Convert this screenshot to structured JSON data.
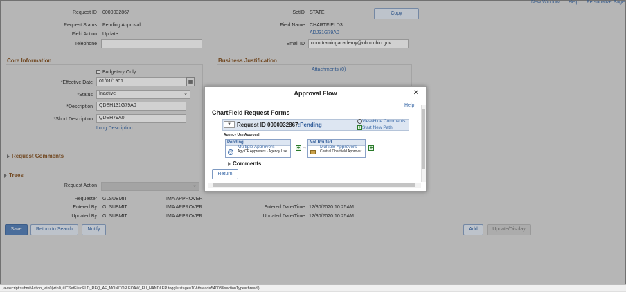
{
  "topnav": {
    "new_window": "New Window",
    "help": "Help",
    "personalize": "Personalize Page"
  },
  "header": {
    "request_id_label": "Request ID",
    "request_id": "0000032867",
    "request_status_label": "Request Status",
    "request_status": "Pending Approval",
    "field_action_label": "Field Action",
    "field_action": "Update",
    "telephone_label": "Telephone",
    "telephone": "",
    "setid_label": "SetID",
    "setid": "STATE",
    "copy_label": "Copy",
    "field_name_label": "Field Name",
    "field_name": "CHARTFIELD3",
    "field_value": "ADJ31G79A0",
    "email_label": "Email ID",
    "email": "obm.trainingacademy@obm.ohio.gov"
  },
  "core": {
    "title": "Core Information",
    "budgetary_only": "Budgetary Only",
    "eff_date_label": "*Effective Date",
    "eff_date": "01/01/1901",
    "status_label": "*Status",
    "status": "Inactive",
    "description_label": "*Description",
    "description": "QDEH131G79A0",
    "short_desc_label": "*Short Description",
    "short_desc": "QDEH79A0",
    "long_desc_link": "Long Description"
  },
  "business": {
    "title": "Business Justification",
    "attachments": "Attachments (0)"
  },
  "sections": {
    "request_comments": "Request Comments",
    "trees": "Trees"
  },
  "bottom": {
    "request_action_label": "Request Action",
    "request_action": "",
    "requester_label": "Requester",
    "requester_id": "GLSUBMIT",
    "requester_name": "IMA APPROVER",
    "entered_by_label": "Entered By",
    "entered_by_id": "GLSUBMIT",
    "entered_by_name": "IMA APPROVER",
    "updated_by_label": "Updated By",
    "updated_by_id": "GLSUBMIT",
    "updated_by_name": "IMA APPROVER",
    "entered_dt_label": "Entered Date/Time",
    "entered_dt": "12/30/2020 10:25AM",
    "updated_dt_label": "Updated Date/Time",
    "updated_dt": "12/30/2020 10:25AM"
  },
  "buttons": {
    "save": "Save",
    "return_search": "Return to Search",
    "notify": "Notify",
    "add": "Add",
    "update_display": "Update/Display"
  },
  "modal": {
    "title": "Approval Flow",
    "help": "Help",
    "heading": "ChartField Request Forms",
    "request_label": "Request ID 0000032867",
    "request_status": ":Pending",
    "view_hide": "View/Hide Comments",
    "start_new_path": "Start New Path",
    "path_name": "Agency Use Approval",
    "stage1": {
      "status": "Pending",
      "approver": "Multiple Approvers",
      "role": "Agy CF Approvers - Agency Use"
    },
    "stage2": {
      "status": "Not Routed",
      "approver": "Multiple Approvers",
      "role": "Central Chartfield Approver"
    },
    "comments": "Comments",
    "return": "Return"
  },
  "statusbar": "javascript:submitAction_win0(win0,'#ICSetFieldFLD_REQ_AF_MONITOR.EOAW_FU_HANDLER.toggle:stage=10&thread=54003&sectionType=thread')"
}
